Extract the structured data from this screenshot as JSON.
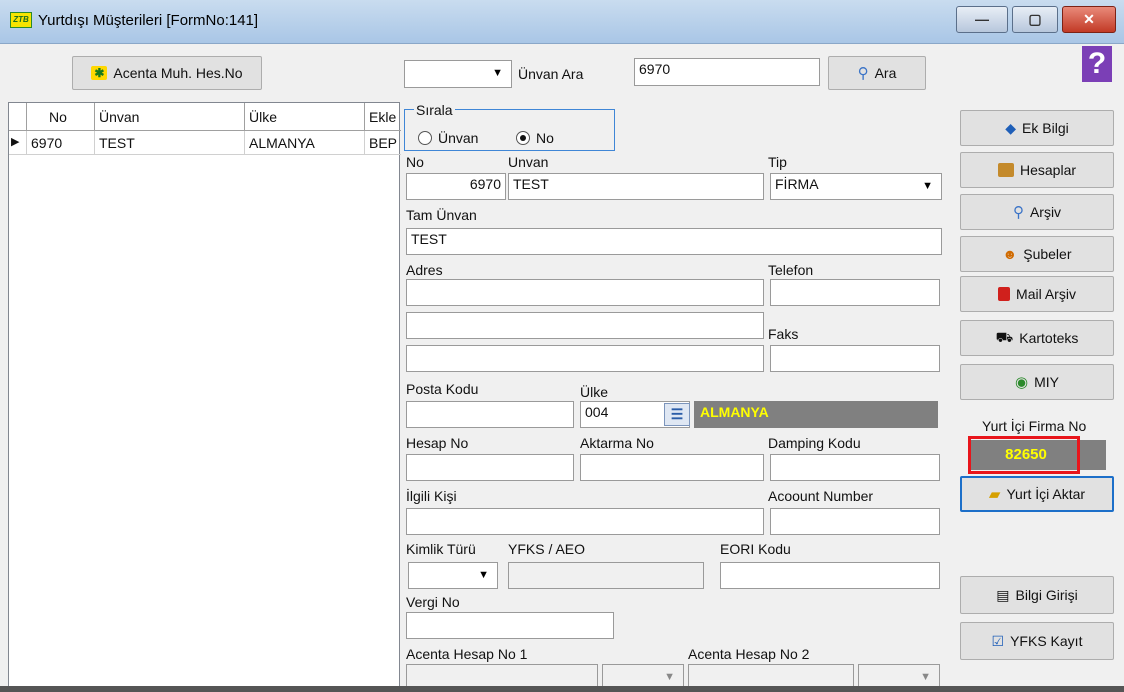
{
  "window": {
    "title": "Yurtdışı Müşterileri [FormNo:141]",
    "logo_text": "ZTB",
    "minimize": "—",
    "maximize": "▢",
    "close": "✕"
  },
  "toolbar": {
    "acenta_button": "Acenta Muh. Hes.No",
    "search_select_value": "",
    "search_label": "Ünvan Ara",
    "search_value": "6970",
    "ara_button": "Ara",
    "help": "?"
  },
  "grid": {
    "columns": [
      "No",
      "Ünvan",
      "Ülke",
      "Ekle"
    ],
    "rows": [
      {
        "no": "6970",
        "unvan": "TEST",
        "ulke": "ALMANYA",
        "ekle": "BEP"
      }
    ]
  },
  "sirala": {
    "title": "Sırala",
    "options": [
      "Ünvan",
      "No"
    ],
    "selected": "No"
  },
  "form": {
    "no_label": "No",
    "no_value": "6970",
    "unvan_label": "Unvan",
    "unvan_value": "TEST",
    "tip_label": "Tip",
    "tip_value": "FİRMA",
    "tam_unvan_label": "Tam Ünvan",
    "tam_unvan_value": "TEST",
    "adres_label": "Adres",
    "adres1": "",
    "adres2": "",
    "adres3": "",
    "telefon_label": "Telefon",
    "telefon_value": "",
    "faks_label": "Faks",
    "faks_value": "",
    "posta_kodu_label": "Posta Kodu",
    "posta_kodu_value": "",
    "ulke_label": "Ülke",
    "ulke_code": "004",
    "ulke_name": "ALMANYA",
    "hesap_no_label": "Hesap No",
    "hesap_no_value": "",
    "aktarma_no_label": "Aktarma No",
    "aktarma_no_value": "",
    "damping_label": "Damping Kodu",
    "damping_value": "",
    "ilgili_label": "İlgili Kişi",
    "ilgili_value": "",
    "account_label": "Acoount Number",
    "account_value": "",
    "kimlik_label": "Kimlik Türü",
    "kimlik_value": "",
    "yfks_label": "YFKS / AEO",
    "yfks_value": "",
    "eori_label": "EORI Kodu",
    "eori_value": "",
    "vergi_label": "Vergi No",
    "vergi_value": "",
    "acenta1_label": "Acenta Hesap No 1",
    "acenta2_label": "Acenta Hesap No 2"
  },
  "side": {
    "ek_bilgi": "Ek Bilgi",
    "hesaplar": "Hesaplar",
    "arsiv": "Arşiv",
    "subeler": "Şubeler",
    "mail_arsiv": "Mail Arşiv",
    "kartoteks": "Kartoteks",
    "miy": "MIY",
    "yurt_ici_firma_label": "Yurt İçi Firma No",
    "yurt_ici_firma_value": "82650",
    "yurt_ici_aktar": "Yurt İçi Aktar",
    "bilgi_girisi": "Bilgi Girişi",
    "yfks_kayit": "YFKS Kayıt"
  },
  "colors": {
    "ulke_badge_bg": "#808080",
    "ulke_badge_text": "#ffff00",
    "highlight_border": "#e8151b",
    "focus_border": "#1c6fc9"
  }
}
